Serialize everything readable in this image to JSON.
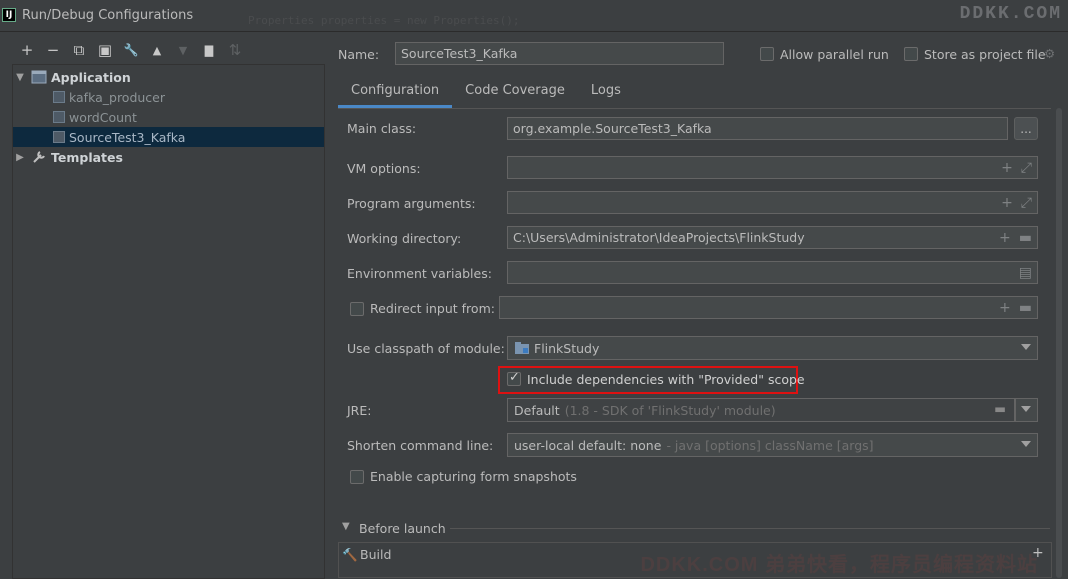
{
  "window": {
    "title": "Run/Debug Configurations",
    "app_icon": "IJ",
    "background_code": "Properties properties = new Properties();",
    "watermark_top": "DDKK.COM",
    "watermark_bottom": "DDKK.COM 弟弟快看，程序员编程资料站"
  },
  "toolbar": {
    "icons": [
      "plus-icon",
      "minus-icon",
      "copy-icon",
      "save-icon",
      "wrench-icon",
      "arrow-up-icon",
      "arrow-down-icon",
      "folder-plus-icon",
      "sort-icon"
    ],
    "glyphs": [
      "+",
      "−",
      "⧉",
      "▣",
      "🔧",
      "▲",
      "▼",
      "▇",
      "⇅"
    ]
  },
  "tree": {
    "application": {
      "label": "Application",
      "arrow": "▼"
    },
    "children": [
      {
        "label": "kafka_producer"
      },
      {
        "label": "wordCount"
      },
      {
        "label": "SourceTest3_Kafka"
      }
    ],
    "templates": {
      "label": "Templates",
      "arrow": "▶"
    }
  },
  "header": {
    "name_label": "Name:",
    "name_value": "SourceTest3_Kafka",
    "allow_parallel": "Allow parallel run",
    "store_as_project": "Store as project file"
  },
  "tabs": [
    {
      "label": "Configuration"
    },
    {
      "label": "Code Coverage"
    },
    {
      "label": "Logs"
    }
  ],
  "form": {
    "main_class_label": "Main class:",
    "main_class_value": "org.example.SourceTest3_Kafka",
    "ellipsis": "...",
    "vm_options_label": "VM options:",
    "program_args_label": "Program arguments:",
    "working_dir_label": "Working directory:",
    "working_dir_value": "C:\\Users\\Administrator\\IdeaProjects\\FlinkStudy",
    "env_vars_label": "Environment variables:",
    "redirect_label": "Redirect input from:",
    "classpath_label": "Use classpath of module:",
    "classpath_value": "FlinkStudy",
    "include_deps_label": "Include dependencies with \"Provided\" scope",
    "jre_label": "JRE:",
    "jre_value": "Default",
    "jre_detail": "(1.8 - SDK of 'FlinkStudy' module)",
    "shorten_label": "Shorten command line:",
    "shorten_value": "user-local default: none",
    "shorten_detail": "- java [options] className [args]",
    "enable_snapshots_label": "Enable capturing form snapshots"
  },
  "before_launch": {
    "label": "Before launch",
    "build_label": "Build"
  }
}
